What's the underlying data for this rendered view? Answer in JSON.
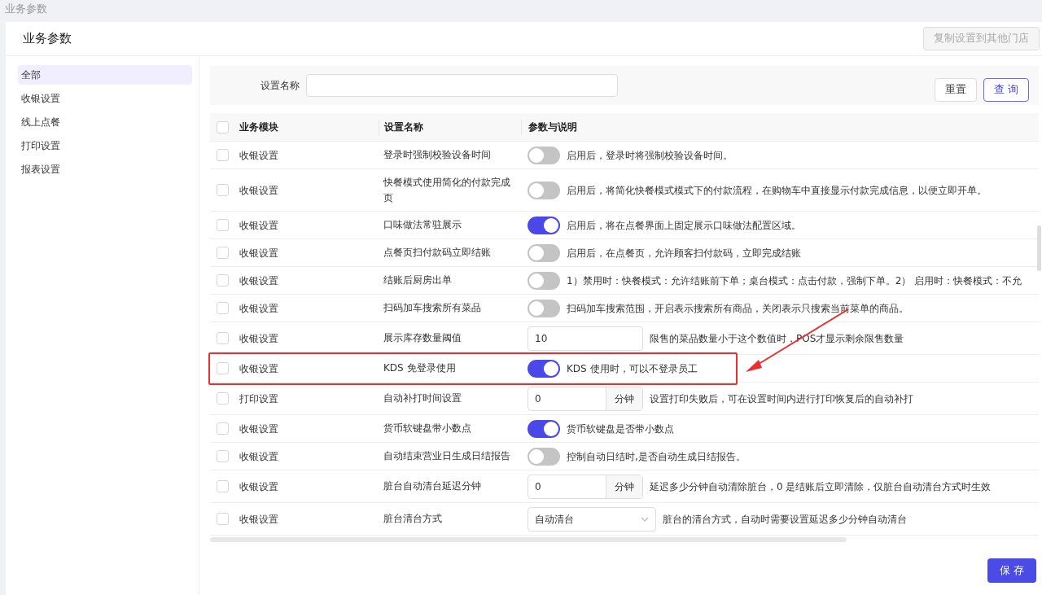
{
  "breadcrumb": "业务参数",
  "page": {
    "title": "业务参数",
    "copy_button": {
      "label": "复制设置到其他门店",
      "disabled": true
    }
  },
  "sidebar": {
    "items": [
      {
        "label": "全部",
        "selected": true
      },
      {
        "label": "收银设置",
        "selected": false
      },
      {
        "label": "线上点餐",
        "selected": false
      },
      {
        "label": "打印设置",
        "selected": false
      },
      {
        "label": "报表设置",
        "selected": false
      }
    ]
  },
  "filter": {
    "label": "设置名称",
    "reset_button": "重置",
    "query_button": "查 询"
  },
  "table": {
    "columns": [
      "业务模块",
      "设置名称",
      "参数与说明"
    ],
    "header_checked": false,
    "rows": [
      {
        "checked": false,
        "module": "收银设置",
        "name": "登录时强制校验设备时间",
        "kind": "toggle",
        "on": false,
        "description": "启用后，登录时将强制校验设备时间。",
        "highlighted": false
      },
      {
        "checked": false,
        "module": "收银设置",
        "name": "快餐模式使用简化的付款完成页",
        "kind": "toggle",
        "on": false,
        "description": "启用后，将简化快餐模式模式下的付款流程，在购物车中直接显示付款完成信息，以便立即开单。",
        "highlighted": false
      },
      {
        "checked": false,
        "module": "收银设置",
        "name": "口味做法常驻展示",
        "kind": "toggle",
        "on": true,
        "description": "启用后，将在点餐界面上固定展示口味做法配置区域。",
        "highlighted": false
      },
      {
        "checked": false,
        "module": "收银设置",
        "name": "点餐页扫付款码立即结账",
        "kind": "toggle",
        "on": false,
        "description": "启用后，在点餐页，允许顾客扫付款码，立即完成结账",
        "highlighted": false
      },
      {
        "checked": false,
        "module": "收银设置",
        "name": "结账后厨房出单",
        "kind": "toggle",
        "on": false,
        "description": "1）禁用时：快餐模式：允许结账前下单；桌台模式：点击付款，强制下单。2） 启用时：快餐模式：不允",
        "highlighted": false
      },
      {
        "checked": false,
        "module": "收银设置",
        "name": "扫码加车搜索所有菜品",
        "kind": "toggle",
        "on": false,
        "description": "扫码加车搜索范围，开启表示搜索所有商品，关闭表示只搜索当前菜单的商品。",
        "highlighted": false
      },
      {
        "checked": false,
        "module": "收银设置",
        "name": "展示库存数量阈值",
        "kind": "number",
        "value": "10",
        "description": "限售的菜品数量小于这个数值时，POS才显示剩余限售数量",
        "highlighted": false
      },
      {
        "checked": false,
        "module": "收银设置",
        "name": "KDS 免登录使用",
        "kind": "toggle",
        "on": true,
        "description": "KDS 使用时，可以不登录员工",
        "highlighted": true
      },
      {
        "checked": false,
        "module": "打印设置",
        "name": "自动补打时间设置",
        "kind": "number",
        "value": "0",
        "unit": "分钟",
        "description": "设置打印失败后，可在设置时间内进行打印恢复后的自动补打",
        "highlighted": false
      },
      {
        "checked": false,
        "module": "收银设置",
        "name": "货币软键盘带小数点",
        "kind": "toggle",
        "on": true,
        "description": "货币软键盘是否带小数点",
        "highlighted": false
      },
      {
        "checked": false,
        "module": "收银设置",
        "name": "自动结束营业日生成日结报告",
        "kind": "toggle",
        "on": false,
        "description": "控制自动日结时,是否自动生成日结报告。",
        "highlighted": false
      },
      {
        "checked": false,
        "module": "收银设置",
        "name": "脏台自动清台延迟分钟",
        "kind": "number",
        "value": "0",
        "unit": "分钟",
        "description": "延迟多少分钟自动清除脏台，0 是结账后立即清除，仅脏台自动清台方式时生效",
        "highlighted": false
      },
      {
        "checked": false,
        "module": "收银设置",
        "name": "脏台清台方式",
        "kind": "select",
        "value": "自动清台",
        "description": "脏台的清台方式，自动时需要设置延迟多少分钟自动清台",
        "highlighted": false
      }
    ]
  },
  "save_button": "保 存"
}
